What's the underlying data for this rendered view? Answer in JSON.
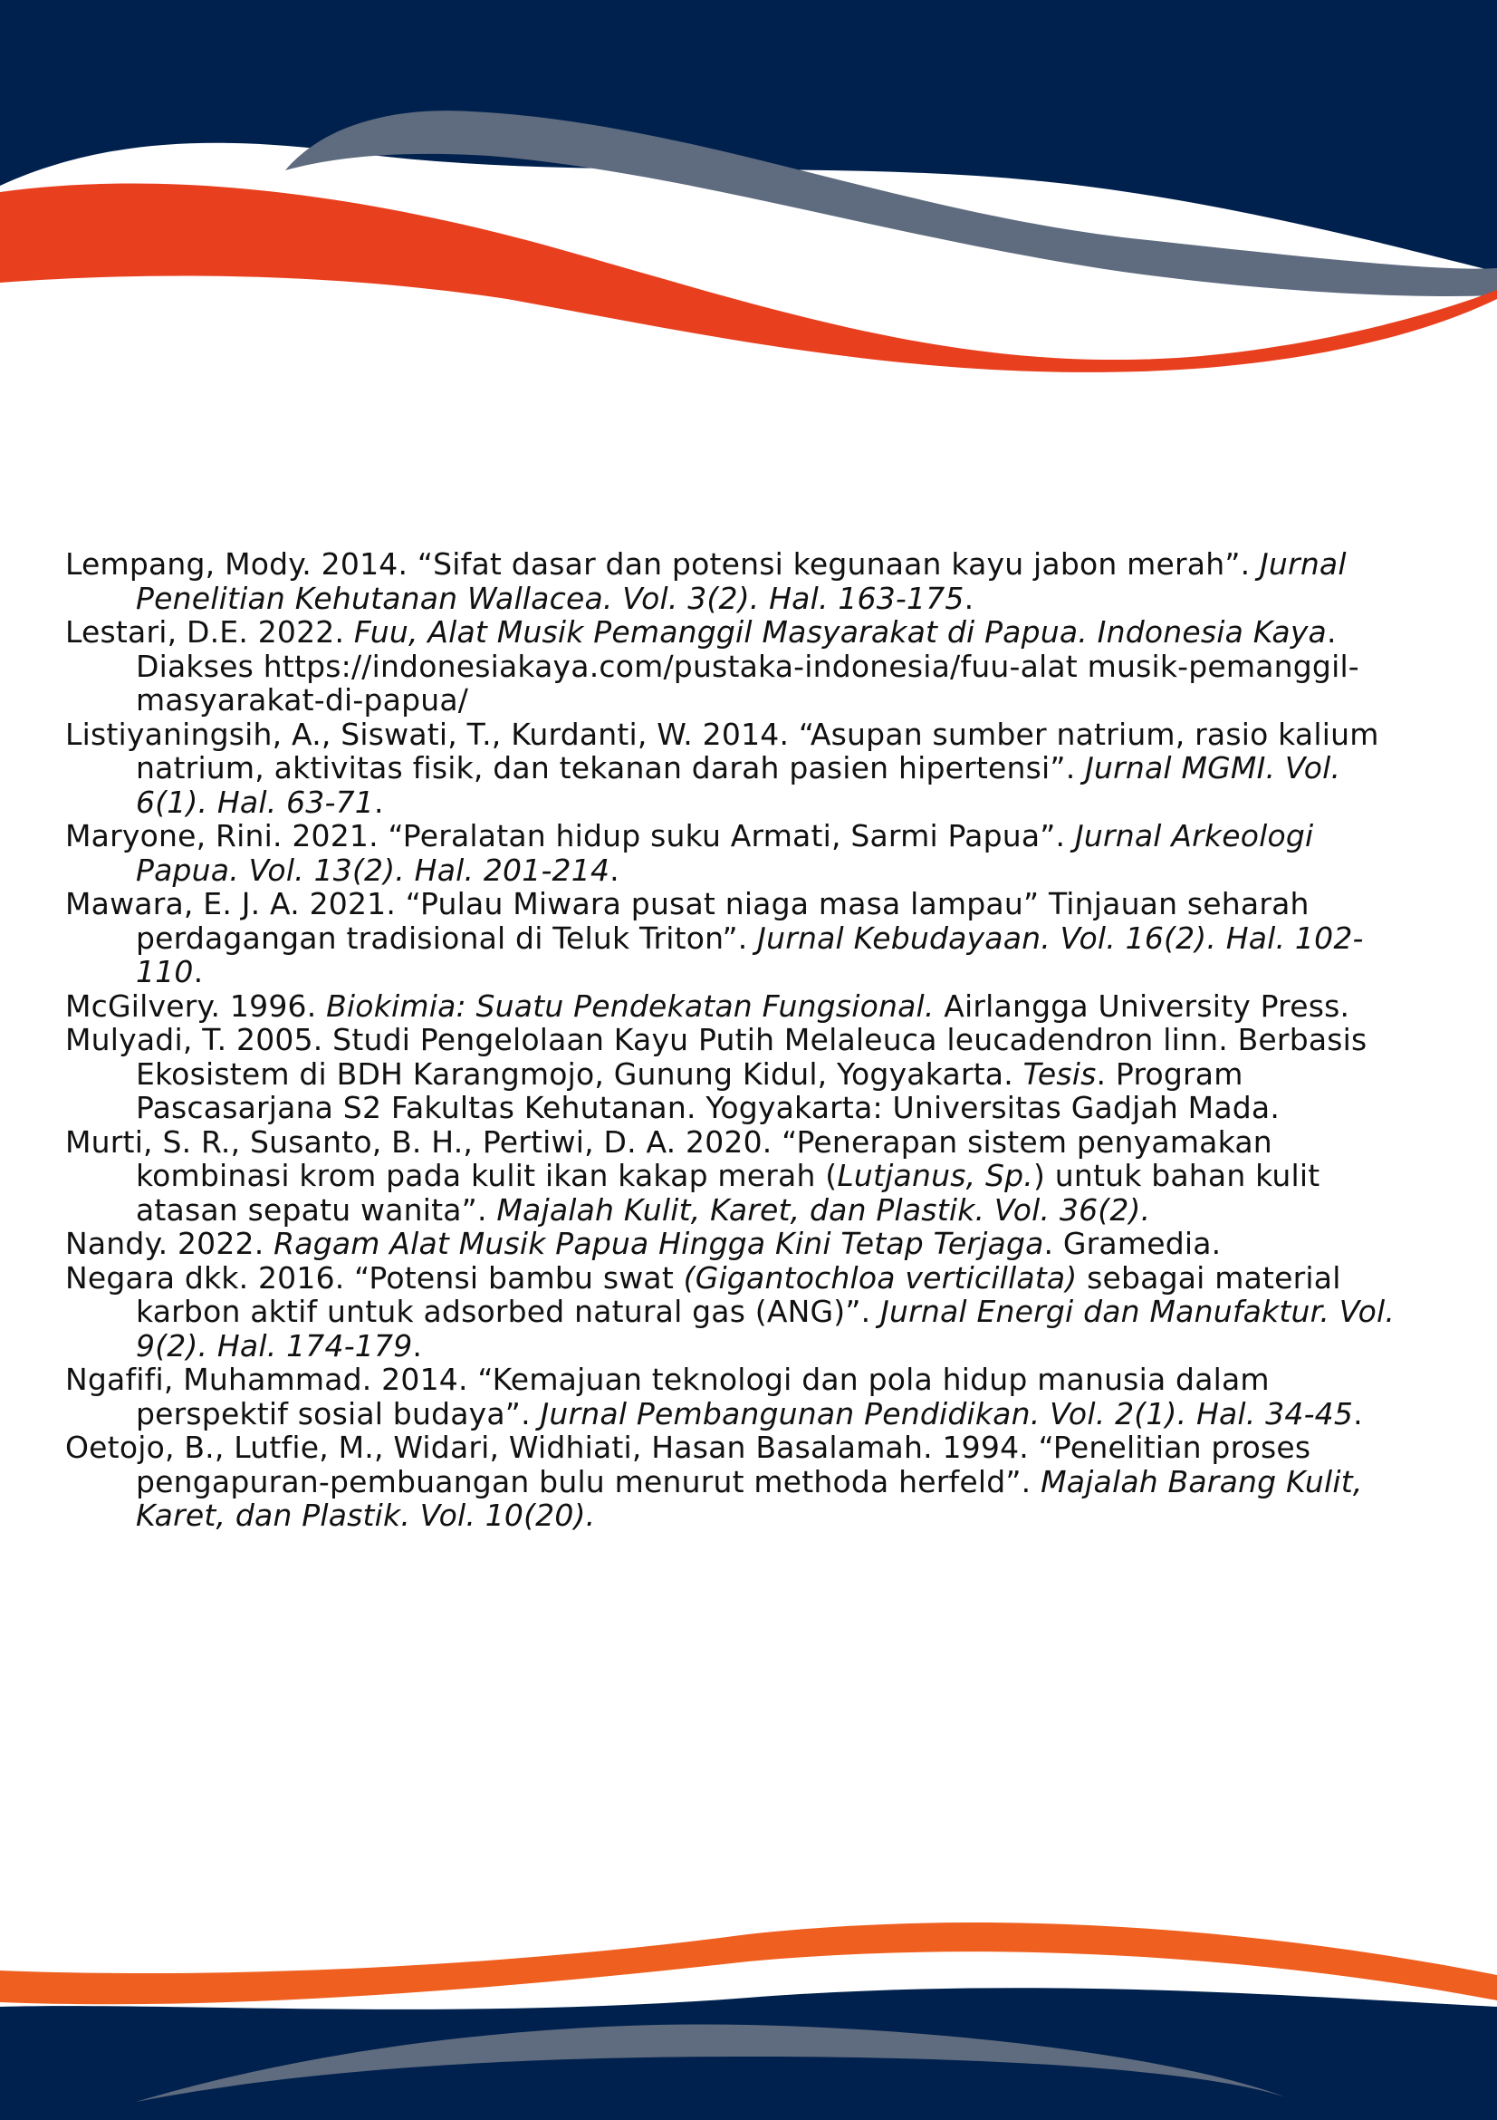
{
  "colors": {
    "navy": "#00214d",
    "slate": "#5f6b7f",
    "orange_red": "#e8401f",
    "orange": "#ef5f1f"
  },
  "references": [
    {
      "parts": [
        {
          "t": "Lempang, Mody. 2014. “Sifat dasar dan potensi kegunaan kayu jabon merah”. ",
          "i": false
        },
        {
          "t": "Jurnal Penelitian Kehutanan Wallacea. Vol. 3(2). Hal. 163-175",
          "i": true
        },
        {
          "t": ".",
          "i": false
        }
      ]
    },
    {
      "parts": [
        {
          "t": "Lestari, D.E. 2022. ",
          "i": false
        },
        {
          "t": "Fuu, Alat Musik Pemanggil Masyarakat di Papua. Indonesia Kaya",
          "i": true
        },
        {
          "t": ". Diakses https://indonesiakaya.com/pustaka-indonesia/fuu-alat musik-pemanggil-masyarakat-di-papua/",
          "i": false
        }
      ]
    },
    {
      "parts": [
        {
          "t": "Listiyaningsih, A., Siswati, T., Kurdanti, W. 2014. “Asupan sumber natrium, rasio kalium natrium, aktivitas fisik, dan tekanan darah pasien hipertensi”. ",
          "i": false
        },
        {
          "t": "Jurnal MGMI. Vol. 6(1). Hal. 63-71",
          "i": true
        },
        {
          "t": ".",
          "i": false
        }
      ]
    },
    {
      "parts": [
        {
          "t": "Maryone, Rini. 2021. “Peralatan hidup suku Armati, Sarmi Papua”. ",
          "i": false
        },
        {
          "t": "Jurnal Arkeologi Papua. Vol. 13(2). Hal. 201-214",
          "i": true
        },
        {
          "t": ".",
          "i": false
        }
      ]
    },
    {
      "parts": [
        {
          "t": "Mawara, E. J. A. 2021. “Pulau Miwara pusat niaga masa lampau” Tinjauan seharah perdagangan tradisional di Teluk Triton”. ",
          "i": false
        },
        {
          "t": "Jurnal Kebudayaan. Vol. 16(2). Hal. 102-110",
          "i": true
        },
        {
          "t": ".",
          "i": false
        }
      ]
    },
    {
      "parts": [
        {
          "t": "McGilvery. 1996. ",
          "i": false
        },
        {
          "t": "Biokimia: Suatu Pendekatan Fungsional.",
          "i": true
        },
        {
          "t": " Airlangga University Press.",
          "i": false
        }
      ]
    },
    {
      "parts": [
        {
          "t": "Mulyadi, T. 2005. Studi Pengelolaan Kayu Putih Melaleuca leucadendron linn. Berbasis Ekosistem di BDH Karangmojo, Gunung Kidul, Yogyakarta. ",
          "i": false
        },
        {
          "t": "Tesis",
          "i": true
        },
        {
          "t": ". Program Pascasarjana S2 Fakultas Kehutanan. Yogyakarta: Universitas Gadjah Mada.",
          "i": false
        }
      ]
    },
    {
      "parts": [
        {
          "t": "Murti, S. R., Susanto, B. H., Pertiwi, D. A. 2020. “Penerapan sistem penyamakan kombinasi krom pada kulit ikan kakap merah (",
          "i": false
        },
        {
          "t": "Lutjanus, Sp.",
          "i": true
        },
        {
          "t": ") untuk bahan kulit atasan sepatu wanita”. ",
          "i": false
        },
        {
          "t": "Majalah Kulit, Karet, dan Plastik. Vol. 36(2).",
          "i": true
        }
      ]
    },
    {
      "parts": [
        {
          "t": "Nandy. 2022. ",
          "i": false
        },
        {
          "t": "Ragam Alat Musik Papua Hingga Kini Tetap Terjaga",
          "i": true
        },
        {
          "t": ". Gramedia.",
          "i": false
        }
      ]
    },
    {
      "parts": [
        {
          "t": "Negara dkk. 2016. “Potensi bambu swat ",
          "i": false
        },
        {
          "t": "(Gigantochloa verticillata)",
          "i": true
        },
        {
          "t": " sebagai material karbon aktif untuk adsorbed natural gas (ANG)”. ",
          "i": false
        },
        {
          "t": "Jurnal Energi dan Manufaktur. Vol. 9(2). Hal. 174-179",
          "i": true
        },
        {
          "t": ".",
          "i": false
        }
      ]
    },
    {
      "parts": [
        {
          "t": "Ngafifi, Muhammad. 2014. “Kemajuan teknologi dan pola hidup manusia dalam perspektif sosial budaya”. ",
          "i": false
        },
        {
          "t": "Jurnal Pembangunan Pendidikan. Vol. 2(1). Hal. 34-45",
          "i": true
        },
        {
          "t": ".",
          "i": false
        }
      ]
    },
    {
      "parts": [
        {
          "t": "Oetojo, B., Lutfie, M., Widari, Widhiati, Hasan Basalamah. 1994. “Penelitian proses pengapuran-pembuangan bulu menurut methoda herfeld”. ",
          "i": false
        },
        {
          "t": "Majalah Barang Kulit, Karet, dan Plastik. Vol. 10(20).",
          "i": true
        }
      ]
    }
  ]
}
